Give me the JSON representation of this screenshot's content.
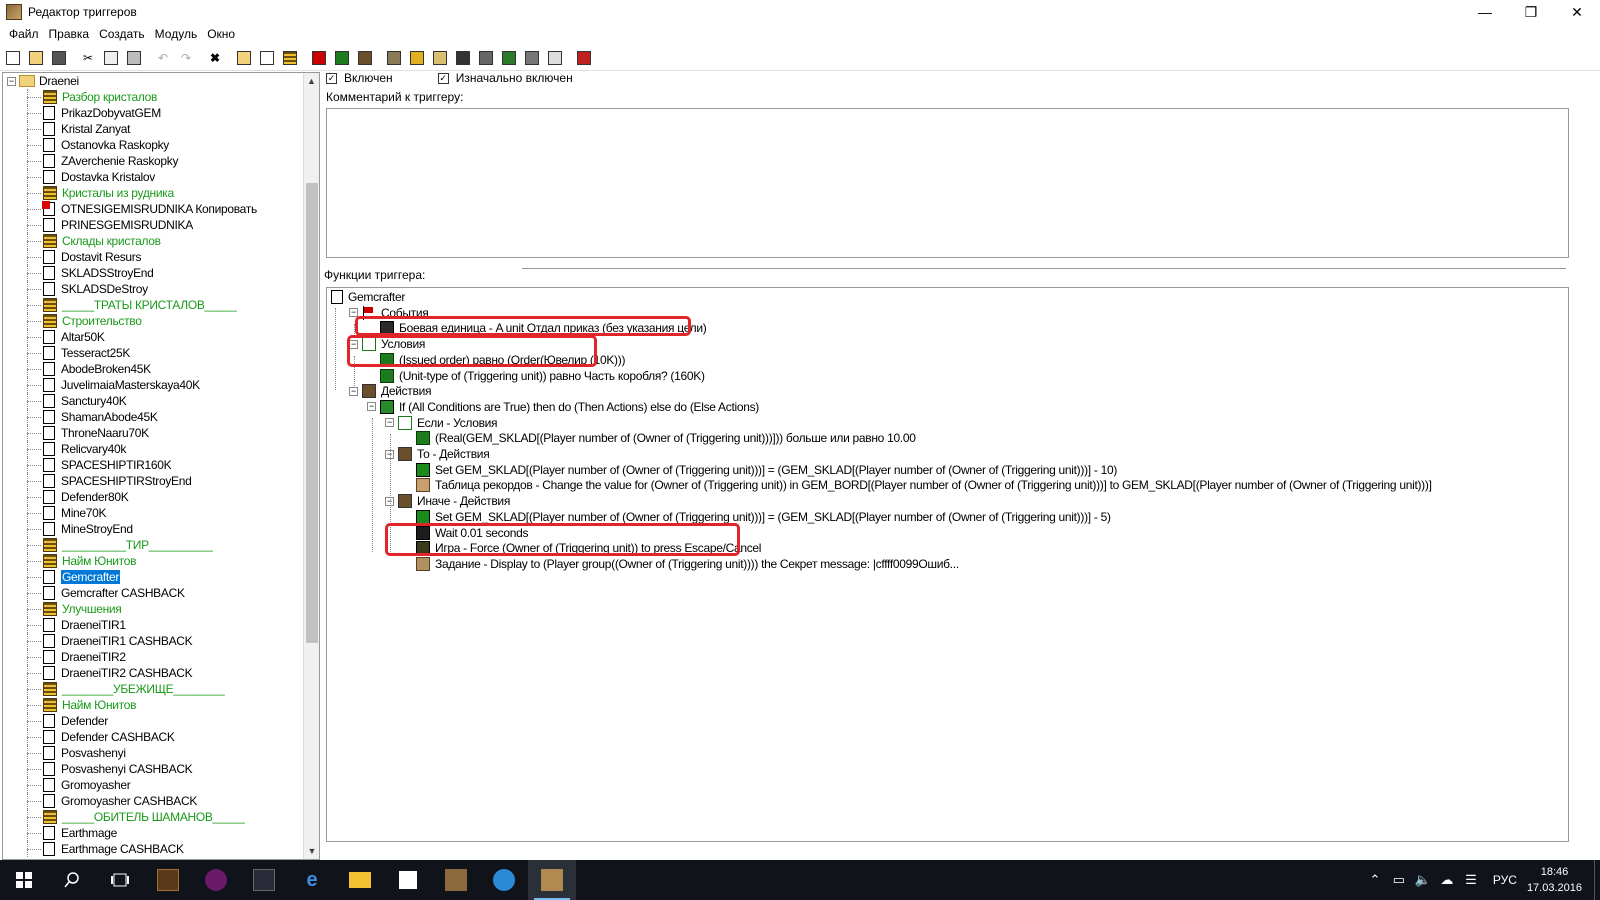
{
  "window": {
    "title": "Редактор триггеров",
    "buttons": [
      "—",
      "❐",
      "✕"
    ]
  },
  "menu": [
    "Файл",
    "Правка",
    "Создать",
    "Модуль",
    "Окно"
  ],
  "left_tree": {
    "root": "Draenei",
    "items": [
      {
        "label": "Разбор кристалов",
        "type": "comment"
      },
      {
        "label": "PrikazDobyvatGEM",
        "type": "trigger"
      },
      {
        "label": "Kristal Zanyat",
        "type": "trigger"
      },
      {
        "label": "Ostanovka Raskopky",
        "type": "trigger"
      },
      {
        "label": "ZAverchenie Raskopky",
        "type": "trigger"
      },
      {
        "label": "Dostavka Kristalov",
        "type": "trigger"
      },
      {
        "label": "Кристалы из рудника",
        "type": "comment"
      },
      {
        "label": "OTNESIGEMISRUDNIKA Копировать",
        "type": "disabled"
      },
      {
        "label": "PRINESGEMISRUDNIKA",
        "type": "trigger"
      },
      {
        "label": "Склады кристалов",
        "type": "comment"
      },
      {
        "label": "Dostavit Resurs",
        "type": "trigger"
      },
      {
        "label": "SKLADSStroyEnd",
        "type": "trigger"
      },
      {
        "label": "SKLADSDeStroy",
        "type": "trigger"
      },
      {
        "label": "_____ТРАТЫ КРИСТАЛОВ_____",
        "type": "comment"
      },
      {
        "label": "Строительство",
        "type": "comment"
      },
      {
        "label": "Altar50K",
        "type": "trigger"
      },
      {
        "label": "Tesseract25K",
        "type": "trigger"
      },
      {
        "label": "AbodeBroken45K",
        "type": "trigger"
      },
      {
        "label": "JuvelimaiaMasterskaya40K",
        "type": "trigger"
      },
      {
        "label": "Sanctury40K",
        "type": "trigger"
      },
      {
        "label": "ShamanAbode45K",
        "type": "trigger"
      },
      {
        "label": "ThroneNaaru70K",
        "type": "trigger"
      },
      {
        "label": "Relicvary40k",
        "type": "trigger"
      },
      {
        "label": "SPACESHIPTIR160K",
        "type": "trigger"
      },
      {
        "label": "SPACESHIPTIRStroyEnd",
        "type": "trigger"
      },
      {
        "label": "Defender80K",
        "type": "trigger"
      },
      {
        "label": "Mine70K",
        "type": "trigger"
      },
      {
        "label": "MineStroyEnd",
        "type": "trigger"
      },
      {
        "label": "__________ТИР__________",
        "type": "comment"
      },
      {
        "label": "Найм Юнитов",
        "type": "comment"
      },
      {
        "label": "Gemcrafter",
        "type": "trigger",
        "selected": true
      },
      {
        "label": "Gemcrafter CASHBACK",
        "type": "trigger"
      },
      {
        "label": "Улучшения",
        "type": "comment"
      },
      {
        "label": "DraeneiTIR1",
        "type": "trigger"
      },
      {
        "label": "DraeneiTIR1 CASHBACK",
        "type": "trigger"
      },
      {
        "label": "DraeneiTIR2",
        "type": "trigger"
      },
      {
        "label": "DraeneiTIR2 CASHBACK",
        "type": "trigger"
      },
      {
        "label": "________УБЕЖИЩЕ________",
        "type": "comment"
      },
      {
        "label": "Найм Юнитов",
        "type": "comment"
      },
      {
        "label": "Defender",
        "type": "trigger"
      },
      {
        "label": "Defender CASHBACK",
        "type": "trigger"
      },
      {
        "label": "Posvashenyi",
        "type": "trigger"
      },
      {
        "label": "Posvashenyi CASHBACK",
        "type": "trigger"
      },
      {
        "label": "Gromoyasher",
        "type": "trigger"
      },
      {
        "label": "Gromoyasher CASHBACK",
        "type": "trigger"
      },
      {
        "label": "_____ОБИТЕЛЬ ШАМАНОВ_____",
        "type": "comment"
      },
      {
        "label": "Earthmage",
        "type": "trigger"
      },
      {
        "label": "Earthmage CASHBACK",
        "type": "trigger"
      }
    ]
  },
  "trigger": {
    "enabled_label": "Включен",
    "initially_enabled_label": "Изначально включен",
    "enabled": true,
    "initially_enabled": true,
    "comment_label": "Комментарий к триггеру:",
    "comment_value": "",
    "functions_label": "Функции триггера:"
  },
  "functions": [
    {
      "label": "Gemcrafter",
      "icon": "doc",
      "level": 0
    },
    {
      "label": "События",
      "icon": "flag",
      "level": 1,
      "expander": "−"
    },
    {
      "label": "Боевая единица - A unit Отдал приказ (без указания цели)",
      "icon": "unit",
      "level": 2
    },
    {
      "label": "Условия",
      "icon": "condgrp",
      "level": 1,
      "expander": "−"
    },
    {
      "label": "(Issued order) равно (Order(Ювелир (10K)))",
      "icon": "cond",
      "level": 2
    },
    {
      "label": "(Unit-type of (Triggering unit)) равно Часть коробля? (160K)",
      "icon": "cond",
      "level": 2
    },
    {
      "label": "Действия",
      "icon": "action",
      "level": 1,
      "expander": "−"
    },
    {
      "label": "If (All Conditions are True) then do (Then Actions) else do (Else Actions)",
      "icon": "ifthen",
      "level": 2,
      "expander": "−"
    },
    {
      "label": "Если - Условия",
      "icon": "condgrp",
      "level": 3,
      "expander": "−"
    },
    {
      "label": "(Real(GEM_SKLAD[(Player number of (Owner of (Triggering unit)))])) больше или равно 10.00",
      "icon": "cond",
      "level": 4
    },
    {
      "label": "То - Действия",
      "icon": "action",
      "level": 3,
      "expander": "−"
    },
    {
      "label": "Set GEM_SKLAD[(Player number of (Owner of (Triggering unit)))] = (GEM_SKLAD[(Player number of (Owner of (Triggering unit)))] - 10)",
      "icon": "set",
      "level": 4
    },
    {
      "label": "Таблица рекордов - Change the value for (Owner of (Triggering unit)) in GEM_BORD[(Player number of (Owner of (Triggering unit)))] to GEM_SKLAD[(Player number of (Owner of (Triggering unit)))]",
      "icon": "board",
      "level": 4
    },
    {
      "label": "Иначе - Действия",
      "icon": "action",
      "level": 3,
      "expander": "−"
    },
    {
      "label": "Set GEM_SKLAD[(Player number of (Owner of (Triggering unit)))] = (GEM_SKLAD[(Player number of (Owner of (Triggering unit)))] - 5)",
      "icon": "set",
      "level": 4
    },
    {
      "label": "Wait 0.01 seconds",
      "icon": "wait",
      "level": 4
    },
    {
      "label": "Игра - Force (Owner of (Triggering unit)) to press Escape/Cancel",
      "icon": "game",
      "level": 4
    },
    {
      "label": "Задание - Display to (Player group((Owner of (Triggering unit)))) the Секрет message: |cffff0099Ошиб...",
      "icon": "quest",
      "level": 4
    }
  ],
  "taskbar": {
    "tray_lang": "РУС",
    "time": "18:46",
    "date": "17.03.2016"
  },
  "colors": {
    "highlight": "#e0262a",
    "comment_green": "#1a9a1a",
    "selection": "#0078d7",
    "taskbar": "#101319"
  }
}
